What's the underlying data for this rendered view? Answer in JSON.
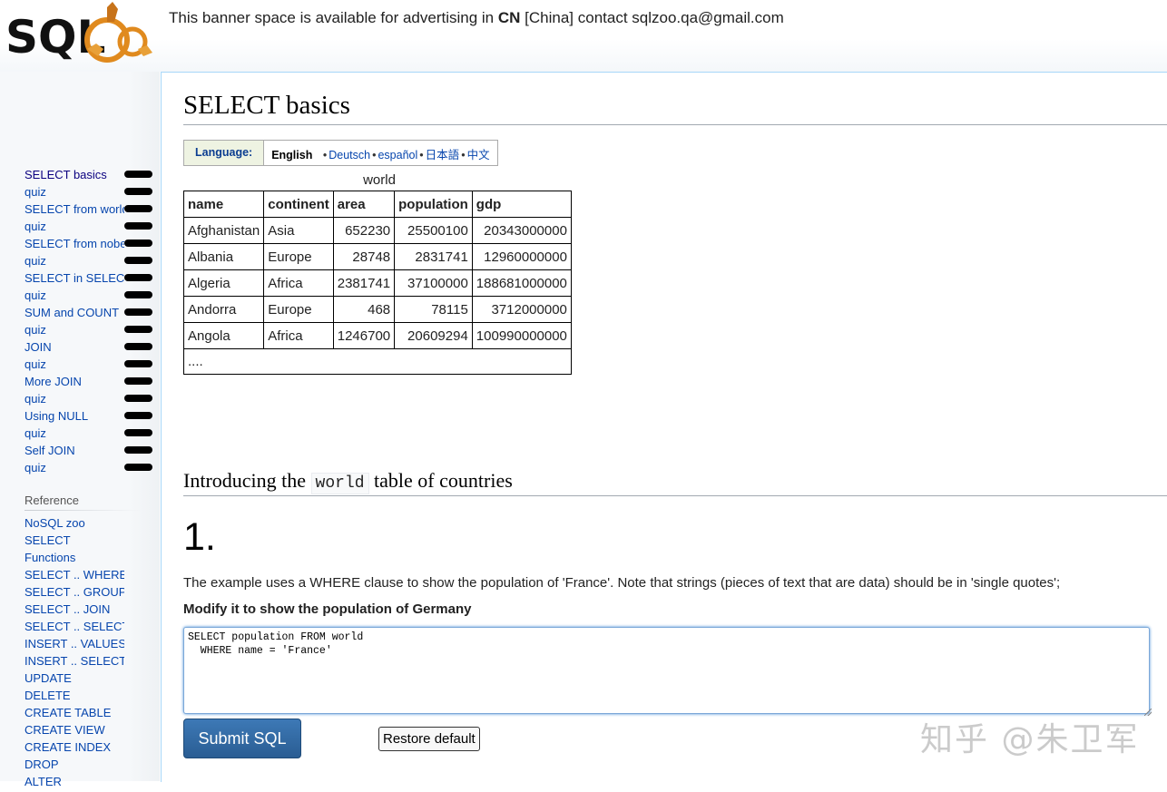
{
  "header": {
    "banner_text": "This banner space is available for advertising in ",
    "banner_bold": "CN",
    "banner_rest": " [China] contact sqlzoo.qa@gmail.com",
    "logo_text": "SQL"
  },
  "sidebar": {
    "tutorials": [
      {
        "label": "SELECT basics"
      },
      {
        "label": "quiz"
      },
      {
        "label": "SELECT from world"
      },
      {
        "label": "quiz"
      },
      {
        "label": "SELECT from nobel"
      },
      {
        "label": "quiz"
      },
      {
        "label": "SELECT in SELECT"
      },
      {
        "label": "quiz"
      },
      {
        "label": "SUM and COUNT"
      },
      {
        "label": "quiz"
      },
      {
        "label": "JOIN"
      },
      {
        "label": "quiz"
      },
      {
        "label": "More JOIN"
      },
      {
        "label": "quiz"
      },
      {
        "label": "Using NULL"
      },
      {
        "label": "quiz"
      },
      {
        "label": "Self JOIN"
      },
      {
        "label": "quiz"
      }
    ],
    "reference_title": "Reference",
    "reference": [
      "NoSQL zoo",
      "SELECT",
      "Functions",
      "SELECT .. WHERE",
      "SELECT .. GROUP BY",
      "SELECT .. JOIN",
      "SELECT .. SELECT",
      "INSERT .. VALUES",
      "INSERT .. SELECT",
      "UPDATE",
      "DELETE",
      "CREATE TABLE",
      "CREATE VIEW",
      "CREATE INDEX",
      "DROP",
      "ALTER"
    ]
  },
  "main": {
    "title": "SELECT basics",
    "language": {
      "label": "Language:",
      "current": "English",
      "others": [
        "Deutsch",
        "español",
        "日本語",
        "中文"
      ]
    },
    "table": {
      "caption": "world",
      "columns": [
        "name",
        "continent",
        "area",
        "population",
        "gdp"
      ],
      "rows": [
        [
          "Afghanistan",
          "Asia",
          "652230",
          "25500100",
          "20343000000"
        ],
        [
          "Albania",
          "Europe",
          "28748",
          "2831741",
          "12960000000"
        ],
        [
          "Algeria",
          "Africa",
          "2381741",
          "37100000",
          "188681000000"
        ],
        [
          "Andorra",
          "Europe",
          "468",
          "78115",
          "3712000000"
        ],
        [
          "Angola",
          "Africa",
          "1246700",
          "20609294",
          "100990000000"
        ]
      ],
      "more": "...."
    },
    "intro": {
      "before": "Introducing the ",
      "code": "world",
      "after": " table of countries"
    },
    "question_number": "1.",
    "description": "The example uses a WHERE clause to show the population of 'France'. Note that strings (pieces of text that are data) should be in 'single quotes';",
    "task": "Modify it to show the population of Germany",
    "sql": "SELECT population FROM world\n  WHERE name = 'France'",
    "submit_label": "Submit SQL",
    "restore_label": "Restore default"
  },
  "watermark": "知乎 @朱卫军",
  "colors": {
    "link": "#0645ad",
    "submit": "#2d6399",
    "sidebar_bg": "#f6f8fa"
  }
}
